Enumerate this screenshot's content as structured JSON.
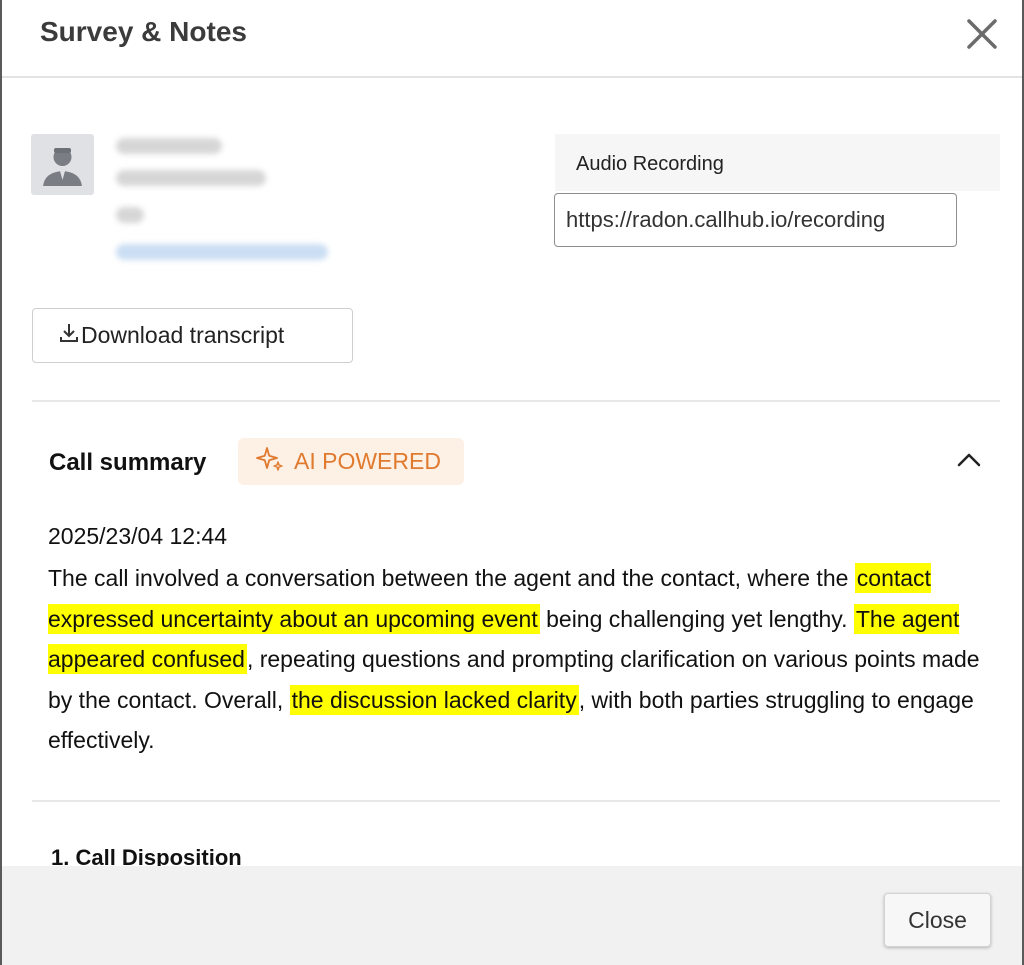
{
  "modal": {
    "title": "Survey & Notes"
  },
  "recording": {
    "label": "Audio Recording",
    "url": "https://radon.callhub.io/recording"
  },
  "actions": {
    "download_label": "Download transcript",
    "close_label": "Close"
  },
  "summary": {
    "title": "Call summary",
    "badge": "AI POWERED",
    "timestamp": "2025/23/04 12:44",
    "segments": [
      {
        "text": "The call involved a conversation between the agent and the contact, where the ",
        "highlight": false
      },
      {
        "text": "contact expressed uncertainty about an upcoming event",
        "highlight": true
      },
      {
        "text": " being challenging yet lengthy. ",
        "highlight": false
      },
      {
        "text": "The agent appeared confused",
        "highlight": true
      },
      {
        "text": ", repeating questions and prompting clarification on various points made by the contact. Overall, ",
        "highlight": false
      },
      {
        "text": "the discussion lacked clarity",
        "highlight": true
      },
      {
        "text": ", with both parties struggling to engage effectively.",
        "highlight": false
      }
    ]
  },
  "survey": {
    "first_question": "1. Call Disposition"
  },
  "icons": {
    "close": "close-icon",
    "avatar": "user-avatar-icon",
    "download": "download-icon",
    "sparkle": "sparkle-icon",
    "collapse": "chevron-up-icon"
  },
  "colors": {
    "highlight": "#ffff00",
    "ai_badge_bg": "#fdf0e4",
    "ai_badge_text": "#e07a2e"
  }
}
